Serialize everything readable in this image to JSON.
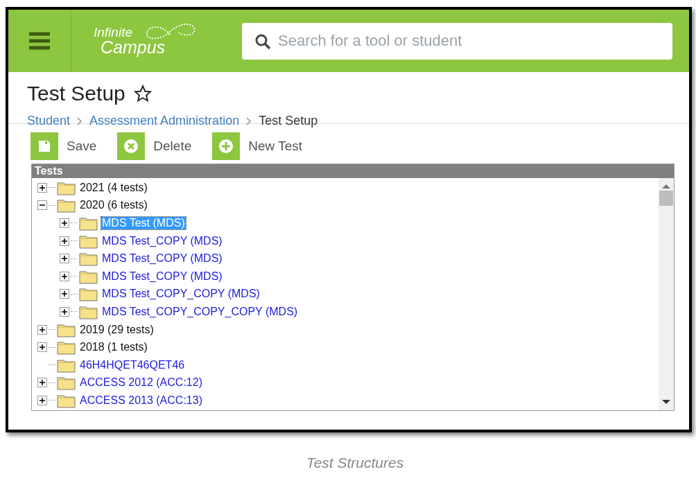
{
  "header": {
    "logo": {
      "line1": "Infinite",
      "line2": "Campus"
    },
    "search": {
      "placeholder": "Search for a tool or student"
    }
  },
  "page": {
    "title": "Test Setup",
    "breadcrumb": [
      {
        "label": "Student",
        "link": true
      },
      {
        "label": "Assessment Administration",
        "link": true
      },
      {
        "label": "Test Setup",
        "link": false
      }
    ]
  },
  "toolbar": [
    {
      "kind": "save",
      "label": "Save"
    },
    {
      "kind": "delete",
      "label": "Delete"
    },
    {
      "kind": "new",
      "label": "New Test"
    }
  ],
  "tree": {
    "title": "Tests",
    "items": [
      {
        "kind": "year",
        "label": "2021 (4 tests)",
        "expanded": false,
        "selected": false
      },
      {
        "kind": "year",
        "label": "2020 (6 tests)",
        "expanded": true,
        "selected": false,
        "children": [
          {
            "kind": "test",
            "label": "MDS Test (MDS)",
            "expanded": false,
            "selected": true
          },
          {
            "kind": "test",
            "label": "MDS Test_COPY (MDS)",
            "expanded": false,
            "selected": false
          },
          {
            "kind": "test",
            "label": "MDS Test_COPY (MDS)",
            "expanded": false,
            "selected": false
          },
          {
            "kind": "test",
            "label": "MDS Test_COPY (MDS)",
            "expanded": false,
            "selected": false
          },
          {
            "kind": "test",
            "label": "MDS Test_COPY_COPY (MDS)",
            "expanded": false,
            "selected": false
          },
          {
            "kind": "test",
            "label": "MDS Test_COPY_COPY_COPY (MDS)",
            "expanded": false,
            "selected": false
          }
        ]
      },
      {
        "kind": "year",
        "label": "2019 (29 tests)",
        "expanded": false,
        "selected": false
      },
      {
        "kind": "year",
        "label": "2018 (1 tests)",
        "expanded": false,
        "selected": false
      },
      {
        "kind": "leaf",
        "label": "46H4HQET46QET46",
        "selected": false
      },
      {
        "kind": "test",
        "label": "ACCESS 2012 (ACC:12)",
        "expanded": false,
        "selected": false
      },
      {
        "kind": "test",
        "label": "ACCESS 2013 (ACC:13)",
        "expanded": false,
        "selected": false
      }
    ]
  },
  "caption": "Test Structures"
}
